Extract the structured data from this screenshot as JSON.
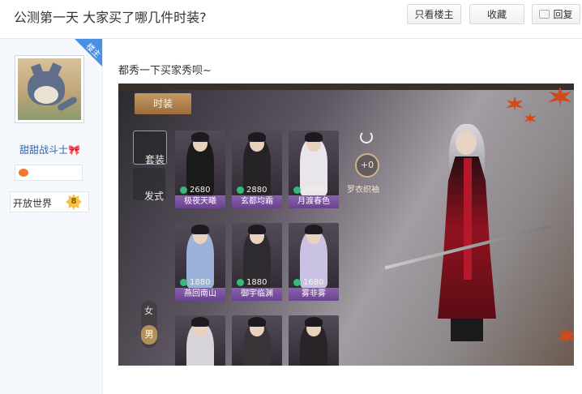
{
  "thread": {
    "title": "公测第一天 大家买了哪几件时装?"
  },
  "toolbar": {
    "only_op": "只看楼主",
    "favorite": "收藏",
    "reply": "回复"
  },
  "author": {
    "badge": "楼主",
    "name": "甜甜战斗士",
    "level_name": "开放世界",
    "level": "8"
  },
  "post": {
    "text": "都秀一下买家秀呗~"
  },
  "game": {
    "tab": "时装",
    "side_tabs": [
      "套装",
      "发式"
    ],
    "cards": [
      {
        "price": "2680",
        "name": "极夜天曦"
      },
      {
        "price": "2880",
        "name": "玄都均霜"
      },
      {
        "price": "2880",
        "name": "月渡春色"
      },
      {
        "price": "1880",
        "name": "燕回南山"
      },
      {
        "price": "1880",
        "name": "御宇临渊"
      },
      {
        "price": "1680",
        "name": "雾非雾"
      }
    ],
    "gender_female": "女",
    "gender_male": "男",
    "plus_value": "+0",
    "plus_label": "罗衣织袖"
  }
}
